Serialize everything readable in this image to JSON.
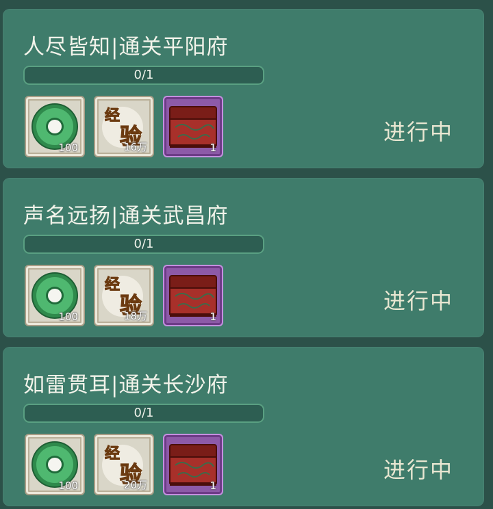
{
  "quests": [
    {
      "title": "人尽皆知|通关平阳府",
      "progress": "0/1",
      "progress_fraction": 0,
      "rewards": [
        {
          "icon": "jade-ring-icon",
          "qty": "100"
        },
        {
          "icon": "experience-scroll-icon",
          "label_top": "经",
          "label_bottom": "验",
          "qty": "16万"
        },
        {
          "icon": "red-treasure-chest-icon",
          "qty": "1"
        }
      ],
      "status": "进行中"
    },
    {
      "title": "声名远扬|通关武昌府",
      "progress": "0/1",
      "progress_fraction": 0,
      "rewards": [
        {
          "icon": "jade-ring-icon",
          "qty": "100"
        },
        {
          "icon": "experience-scroll-icon",
          "label_top": "经",
          "label_bottom": "验",
          "qty": "18万"
        },
        {
          "icon": "red-treasure-chest-icon",
          "qty": "1"
        }
      ],
      "status": "进行中"
    },
    {
      "title": "如雷贯耳|通关长沙府",
      "progress": "0/1",
      "progress_fraction": 0,
      "rewards": [
        {
          "icon": "jade-ring-icon",
          "qty": "100"
        },
        {
          "icon": "experience-scroll-icon",
          "label_top": "经",
          "label_bottom": "验",
          "qty": "20万"
        },
        {
          "icon": "red-treasure-chest-icon",
          "qty": "1"
        }
      ],
      "status": "进行中"
    }
  ],
  "colors": {
    "card": "#3f7c6b",
    "background": "#2c5149",
    "jade": "#3fa45f",
    "exp_text": "#e8a531",
    "chest_red": "#9e2a24",
    "epic_frame": "#8d5aa8"
  }
}
